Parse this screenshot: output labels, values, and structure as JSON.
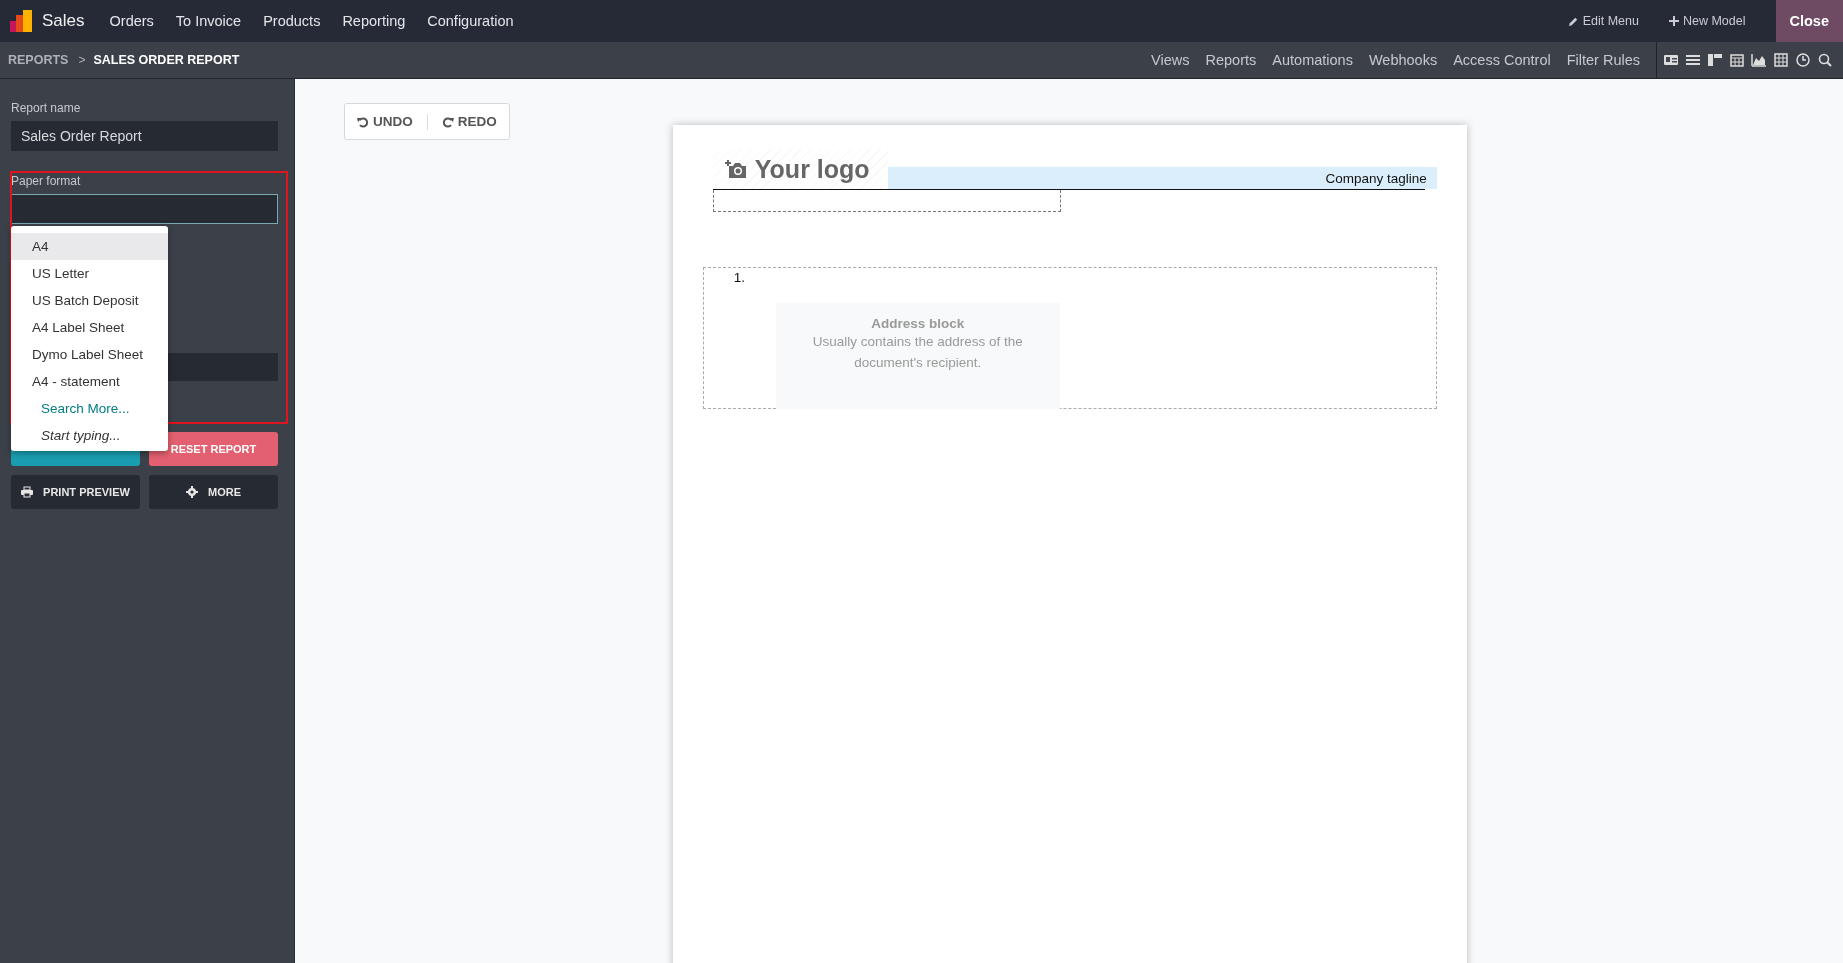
{
  "app": {
    "name": "Sales"
  },
  "menu": [
    "Orders",
    "To Invoice",
    "Products",
    "Reporting",
    "Configuration"
  ],
  "top_actions": [
    {
      "kind": "edit",
      "label": "Edit Menu"
    },
    {
      "kind": "new",
      "label": "New Model"
    }
  ],
  "close_button": "Close",
  "breadcrumb": {
    "items": [
      "REPORTS",
      "SALES ORDER REPORT"
    ],
    "separator": ">"
  },
  "studio_tabs": [
    "Views",
    "Reports",
    "Automations",
    "Webhooks",
    "Access Control",
    "Filter Rules"
  ],
  "sidebar": {
    "report_name": {
      "label": "Report name",
      "value": "Sales Order Report"
    },
    "paper_format": {
      "label": "Paper format"
    }
  },
  "dropdown": {
    "options": [
      {
        "label": "A4",
        "selected": true
      },
      {
        "label": "US Letter",
        "selected": false
      },
      {
        "label": "US Batch Deposit",
        "selected": false
      },
      {
        "label": "A4 Label Sheet",
        "selected": false
      },
      {
        "label": "Dymo Label Sheet",
        "selected": false
      },
      {
        "label": "A4 - statement",
        "selected": false
      }
    ],
    "search_more": "Search More...",
    "hint": "Start typing..."
  },
  "buttons": [
    {
      "kind": "reset",
      "label": "RESET REPORT"
    },
    {
      "kind": "print",
      "label": "PRINT PREVIEW"
    },
    {
      "kind": "more",
      "label": "MORE"
    }
  ],
  "history": [
    {
      "kind": "undo",
      "label": "UNDO"
    },
    {
      "kind": "redo",
      "label": "REDO"
    }
  ],
  "document": {
    "logo": "Your logo",
    "tagline": "Company tagline",
    "list_marker": "1.",
    "address_block": {
      "title": "Address block",
      "text": "Usually contains the address of the document's recipient."
    }
  }
}
